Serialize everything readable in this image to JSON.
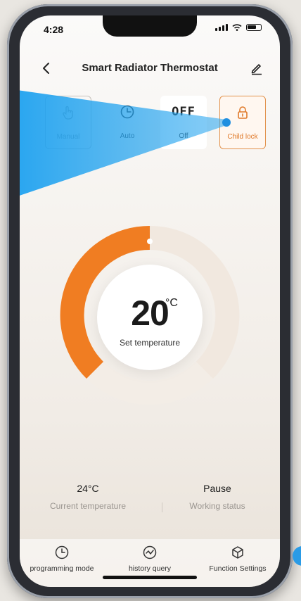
{
  "status_bar": {
    "time": "4:28"
  },
  "header": {
    "title": "Smart Radiator Thermostat"
  },
  "modes": [
    {
      "label": "Manual",
      "icon": "hand-pointer-icon"
    },
    {
      "label": "Auto",
      "icon": "clock-icon"
    },
    {
      "label": "Off",
      "icon_text": "OFF"
    },
    {
      "label": "Child lock",
      "icon": "lock-icon"
    }
  ],
  "dial": {
    "set_value": "20",
    "unit": "°C",
    "label": "Set temperature",
    "accent_color": "#f07d22"
  },
  "info": {
    "current_value": "24°C",
    "current_label": "Current temperature",
    "status_value": "Pause",
    "status_label": "Working status"
  },
  "tabs": [
    {
      "label": "programming mode",
      "icon": "clock-icon"
    },
    {
      "label": "history query",
      "icon": "chart-line-icon"
    },
    {
      "label": "Function Settings",
      "icon": "cube-icon"
    }
  ]
}
